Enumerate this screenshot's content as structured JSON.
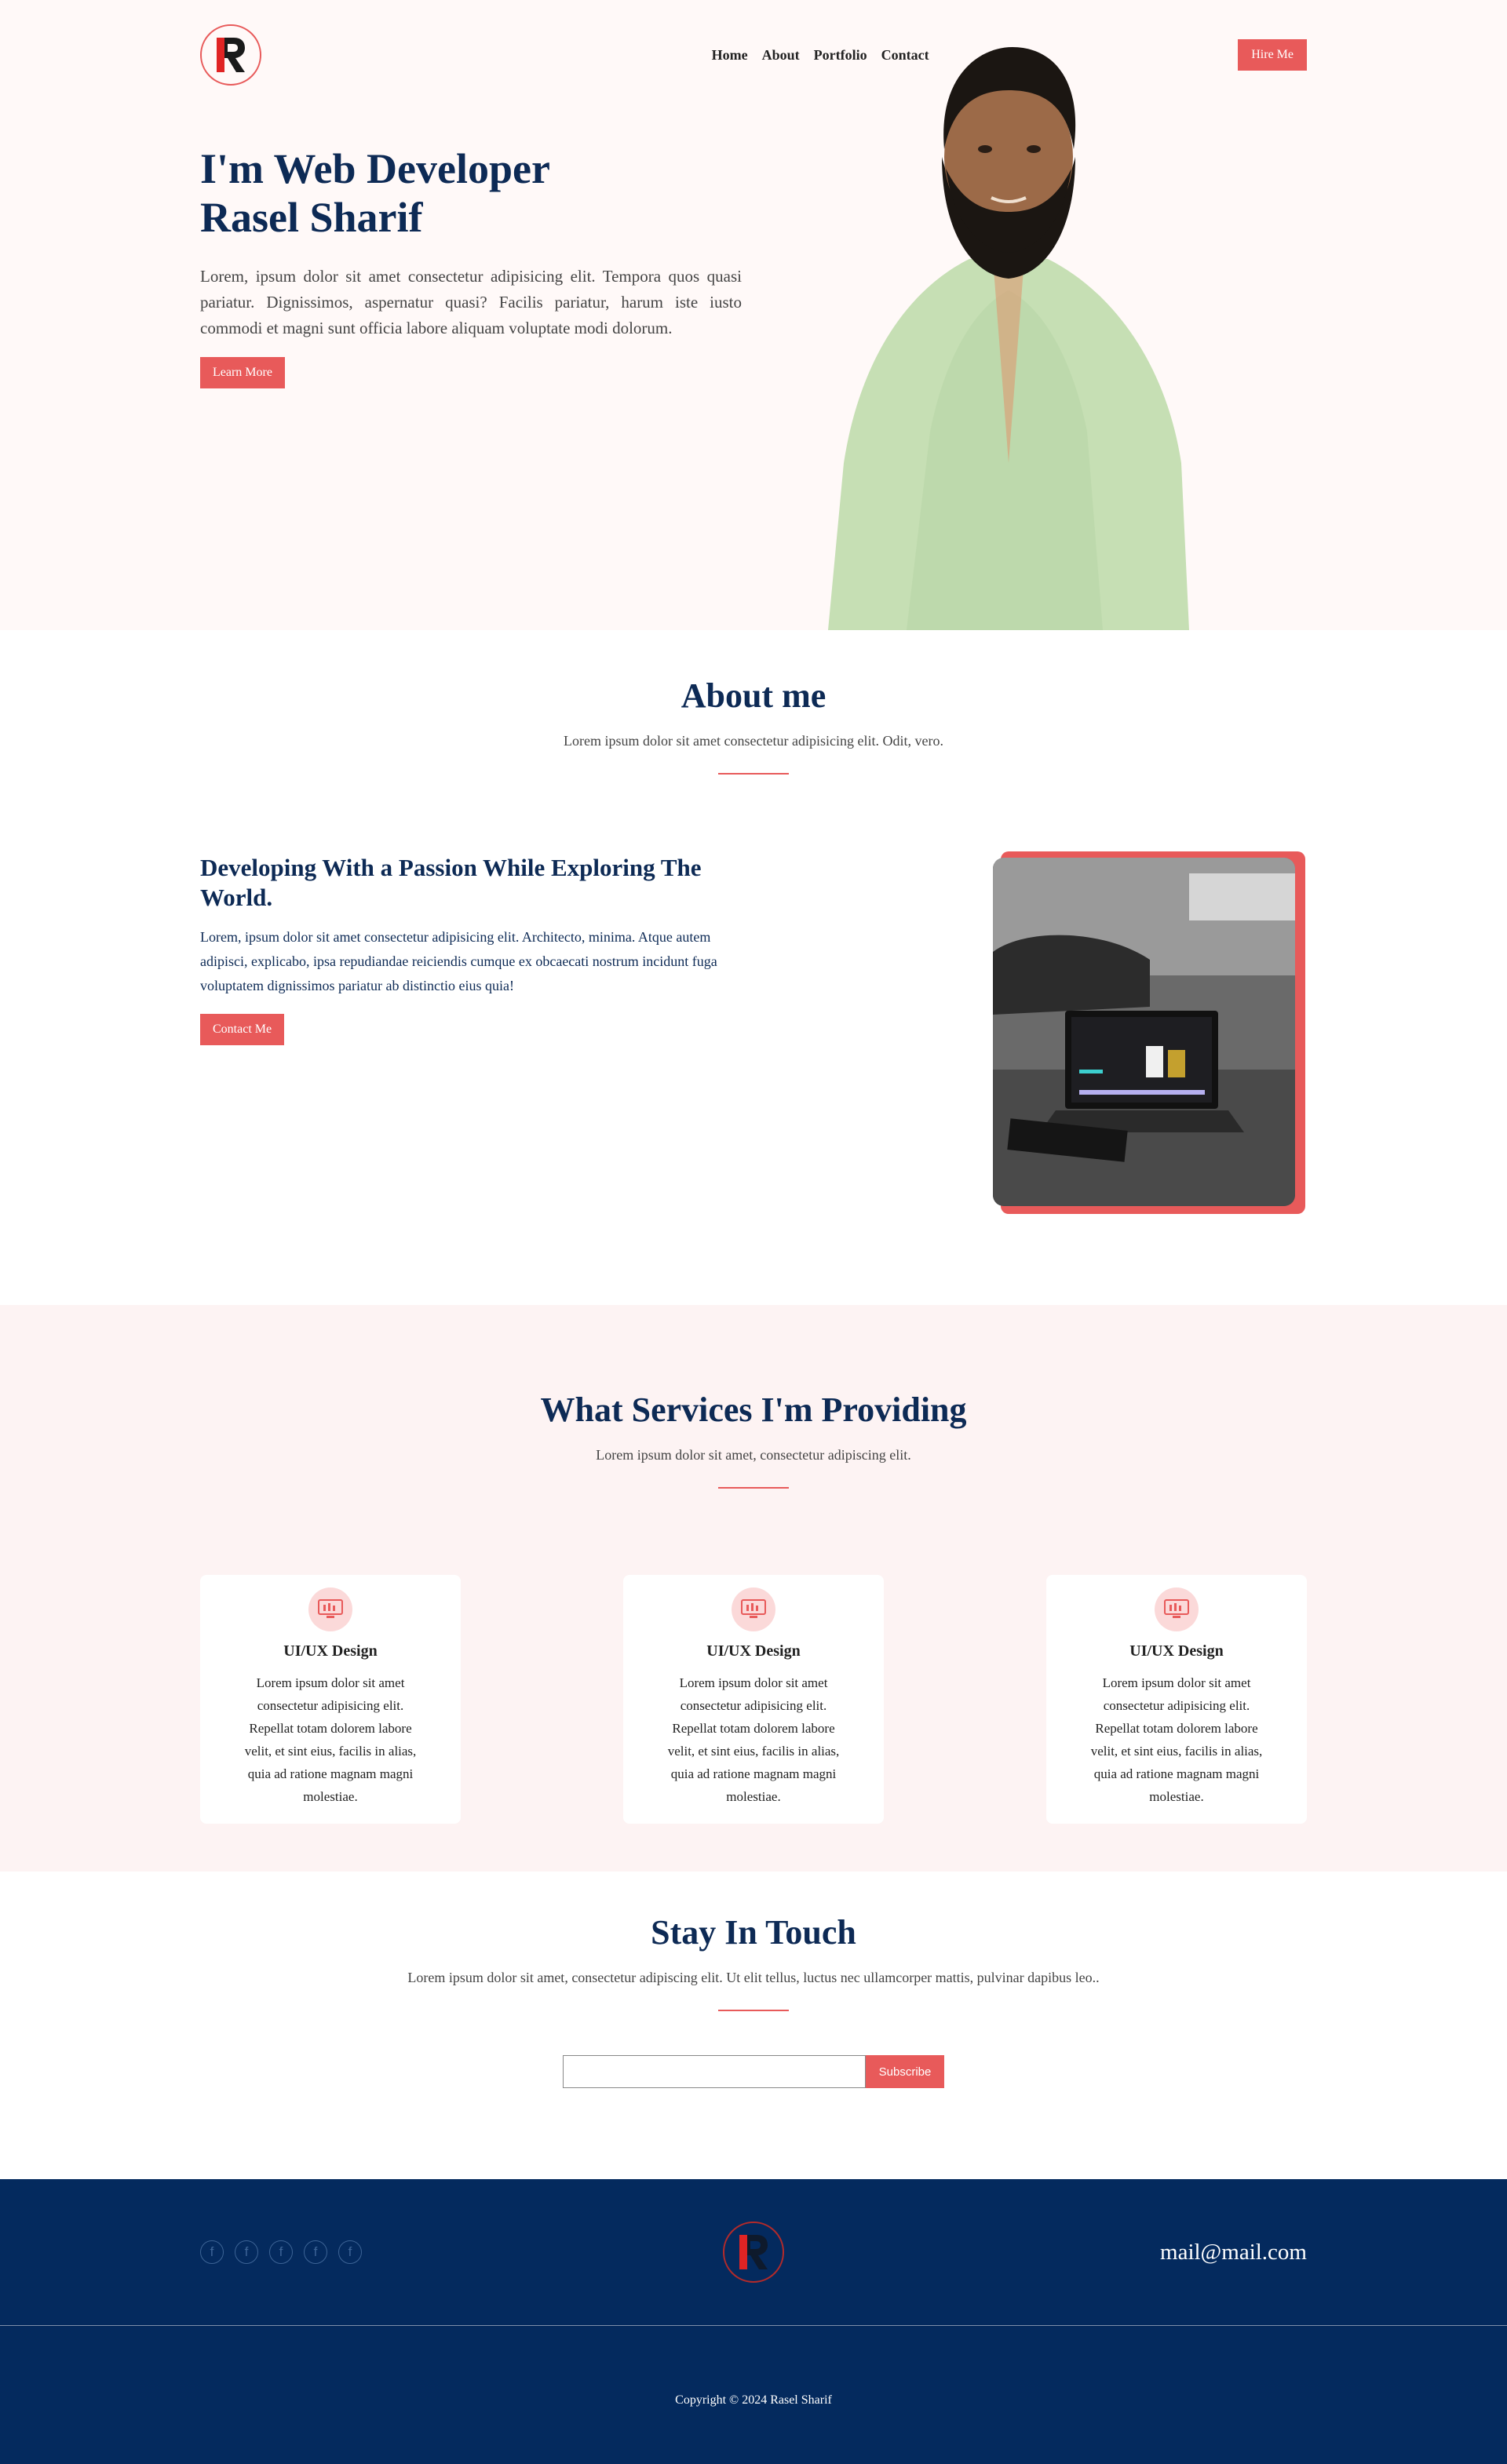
{
  "header": {
    "nav": [
      {
        "label": "Home"
      },
      {
        "label": "About"
      },
      {
        "label": "Portfolio"
      },
      {
        "label": "Contact"
      }
    ],
    "hire_label": "Hire Me"
  },
  "hero": {
    "title_line1": "I'm Web Developer",
    "title_line2": "Rasel Sharif",
    "description": "Lorem, ipsum dolor sit amet consectetur adipisicing elit. Tempora quos quasi pariatur. Dignissimos, aspernatur quasi? Facilis pariatur, harum iste iusto commodi et magni sunt officia labore aliquam voluptate modi dolorum.",
    "button_label": "Learn More"
  },
  "about": {
    "title": "About me",
    "subtitle": "Lorem ipsum dolor sit amet consectetur adipisicing elit. Odit, vero.",
    "heading": "Developing With a Passion While Exploring The World.",
    "description": "Lorem, ipsum dolor sit amet consectetur adipisicing elit. Architecto, minima. Atque autem adipisci, explicabo, ipsa repudiandae reiciendis cumque ex obcaecati nostrum incidunt fuga voluptatem dignissimos pariatur ab distinctio eius quia!",
    "button_label": "Contact Me"
  },
  "services": {
    "title": "What Services I'm Providing",
    "subtitle": "Lorem ipsum dolor sit amet, consectetur adipiscing elit.",
    "cards": [
      {
        "title": "UI/UX Design",
        "description": "Lorem ipsum dolor sit amet consectetur adipisicing elit. Repellat totam dolorem labore velit, et sint eius, facilis in alias, quia ad ratione magnam magni molestiae."
      },
      {
        "title": "UI/UX Design",
        "description": "Lorem ipsum dolor sit amet consectetur adipisicing elit. Repellat totam dolorem labore velit, et sint eius, facilis in alias, quia ad ratione magnam magni molestiae."
      },
      {
        "title": "UI/UX Design",
        "description": "Lorem ipsum dolor sit amet consectetur adipisicing elit. Repellat totam dolorem labore velit, et sint eius, facilis in alias, quia ad ratione magnam magni molestiae."
      }
    ]
  },
  "touch": {
    "title": "Stay In Touch",
    "subtitle": "Lorem ipsum dolor sit amet, consectetur adipiscing elit. Ut elit tellus, luctus nec ullamcorper mattis, pulvinar dapibus leo..",
    "input_value": "",
    "button_label": "Subscribe"
  },
  "footer": {
    "social_icons": [
      "facebook-icon",
      "facebook-icon",
      "facebook-icon",
      "facebook-icon",
      "facebook-icon"
    ],
    "social_glyph": "f",
    "email": "mail@mail.com",
    "copyright": "Copyright © 2024 Rasel Sharif"
  },
  "colors": {
    "accent": "#e85a5a",
    "navy": "#0d2a55",
    "footer_bg": "#042a5e",
    "hero_bg": "#fff9f8",
    "services_bg": "#fdf3f3"
  }
}
